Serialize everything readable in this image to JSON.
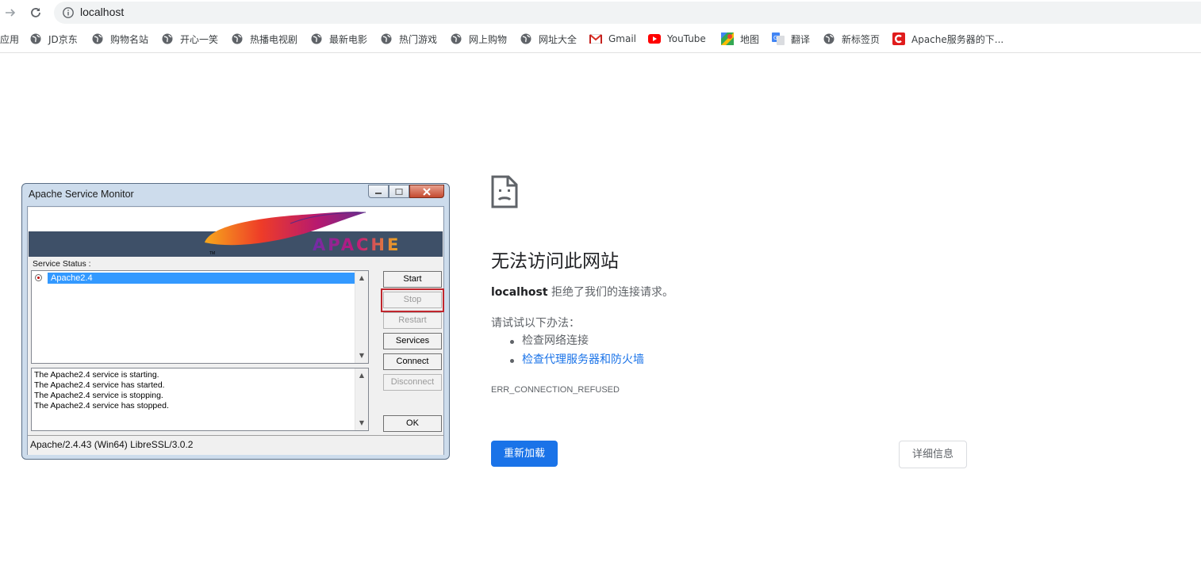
{
  "browser": {
    "url": "localhost",
    "bookmarks": [
      {
        "label": "应用",
        "icon": "apps-icon"
      },
      {
        "label": "JD京东",
        "icon": "globe-icon"
      },
      {
        "label": "购物名站",
        "icon": "globe-icon"
      },
      {
        "label": "开心一笑",
        "icon": "globe-icon"
      },
      {
        "label": "热播电视剧",
        "icon": "globe-icon"
      },
      {
        "label": "最新电影",
        "icon": "globe-icon"
      },
      {
        "label": "热门游戏",
        "icon": "globe-icon"
      },
      {
        "label": "网上购物",
        "icon": "globe-icon"
      },
      {
        "label": "网址大全",
        "icon": "globe-icon"
      },
      {
        "label": "Gmail",
        "icon": "gmail-icon"
      },
      {
        "label": "YouTube",
        "icon": "youtube-icon"
      },
      {
        "label": "地图",
        "icon": "maps-icon"
      },
      {
        "label": "翻译",
        "icon": "translate-icon"
      },
      {
        "label": "新标签页",
        "icon": "globe-icon"
      },
      {
        "label": "Apache服务器的下...",
        "icon": "csdn-icon"
      }
    ]
  },
  "monitor": {
    "title": "Apache Service Monitor",
    "banner_text": "APACHE",
    "status_label": "Service Status :",
    "services": [
      "Apache2.4"
    ],
    "buttons": {
      "start": "Start",
      "stop": "Stop",
      "restart": "Restart",
      "services": "Services",
      "connect": "Connect",
      "disconnect": "Disconnect",
      "ok": "OK"
    },
    "log": [
      "The Apache2.4 service is starting.",
      "The Apache2.4 service has started.",
      "The Apache2.4 service is stopping.",
      "The Apache2.4 service has stopped."
    ],
    "status_bar": "Apache/2.4.43 (Win64) LibreSSL/3.0.2"
  },
  "error_page": {
    "title": "无法访问此网站",
    "host": "localhost",
    "description": "拒绝了我们的连接请求。",
    "try_label": "请试试以下办法：",
    "suggestions": [
      "检查网络连接",
      "检查代理服务器和防火墙"
    ],
    "error_code": "ERR_CONNECTION_REFUSED",
    "reload_button": "重新加载",
    "details_button": "详细信息"
  },
  "colors": {
    "chrome_blue": "#1a73e8",
    "selection_blue": "#3399ff",
    "highlight_red": "#c0262d"
  }
}
